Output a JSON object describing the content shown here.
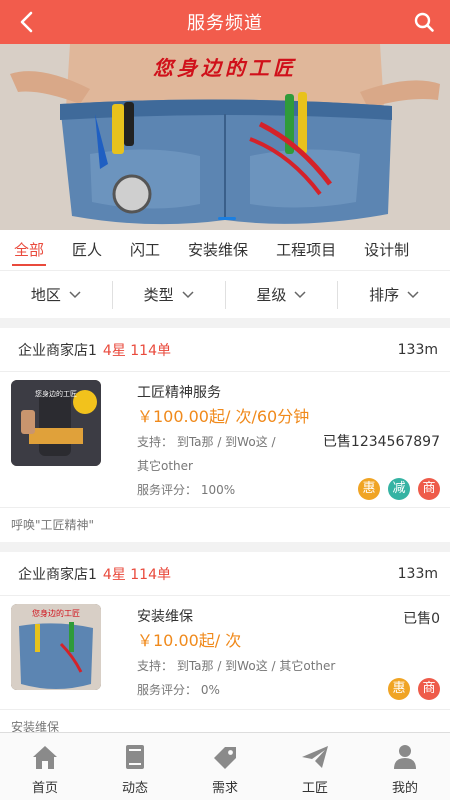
{
  "header": {
    "title": "服务频道"
  },
  "banner": {
    "slogan": "您身边的工匠"
  },
  "tabs": [
    "全部",
    "匠人",
    "闪工",
    "安装维保",
    "工程项目",
    "设计制"
  ],
  "filters": [
    "地区",
    "类型",
    "星级",
    "排序"
  ],
  "cards": [
    {
      "shop_name": "企业商家店1",
      "shop_meta": "4星 114单",
      "distance": "133m",
      "title": "工匠精神服务",
      "price": "￥100.00起/ 次/60分钟",
      "support": "支持： 到Ta那 / 到Wo这 /",
      "support2": "其它other",
      "sold": "已售1234567897",
      "rating": "服务评分： 100%",
      "badges": [
        "惠",
        "减",
        "商"
      ],
      "desc": "呼唤\"工匠精神\""
    },
    {
      "shop_name": "企业商家店1",
      "shop_meta": "4星 114单",
      "distance": "133m",
      "title": "安装维保",
      "price": "￥10.00起/ 次",
      "support": "支持： 到Ta那 / 到Wo这 / 其它other",
      "sold": "已售0",
      "rating": "服务评分： 0%",
      "badges": [
        "惠",
        "商"
      ],
      "desc": "安装维保"
    }
  ],
  "tabbar": [
    {
      "label": "首页",
      "icon": "home-icon"
    },
    {
      "label": "动态",
      "icon": "book-icon"
    },
    {
      "label": "需求",
      "icon": "tag-icon"
    },
    {
      "label": "工匠",
      "icon": "paper-plane-icon"
    },
    {
      "label": "我的",
      "icon": "user-icon"
    }
  ]
}
